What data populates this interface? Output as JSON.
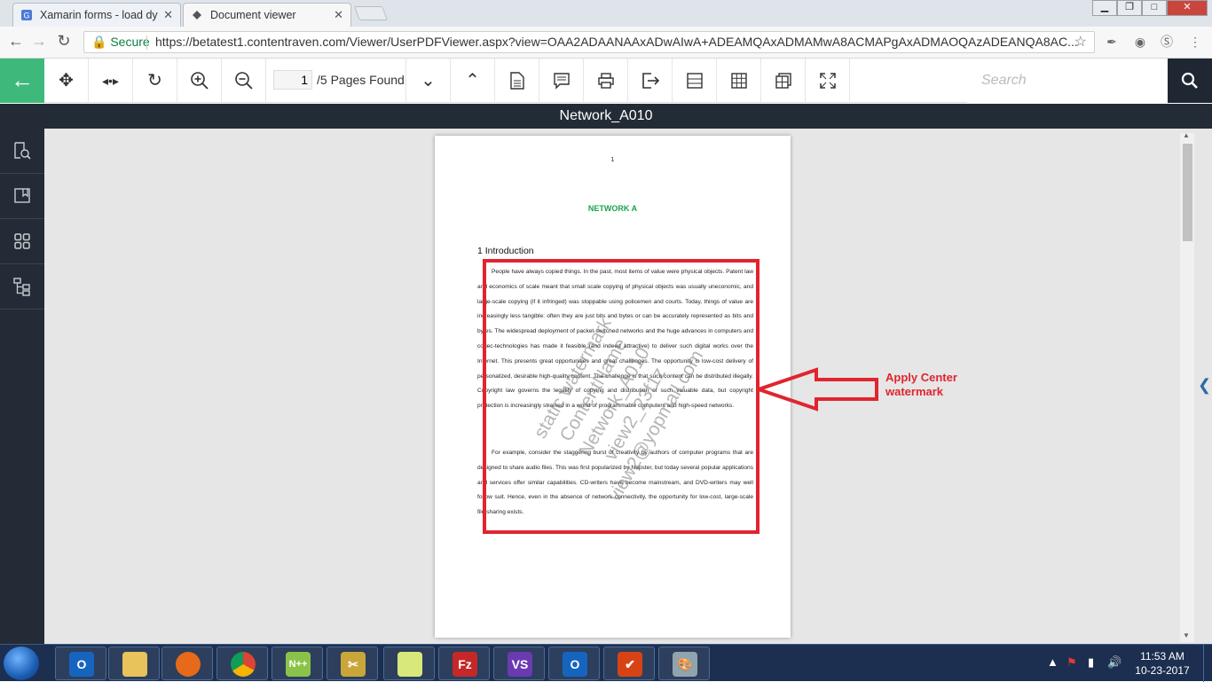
{
  "browser": {
    "tabs": [
      {
        "title": "Xamarin forms - load dy"
      },
      {
        "title": "Document viewer"
      }
    ],
    "address": {
      "secure_label": "Secure",
      "url": "https://betatest1.contentraven.com/Viewer/UserPDFViewer.aspx?view=OAA2ADAANAAxADwAIwA+ADEAMQAxADMAMwA8ACMAPgAxADMAOQAzADEANQA8AC..."
    }
  },
  "toolbar": {
    "page_current": "1",
    "pages_found": "/5 Pages Found",
    "search_placeholder": "Search"
  },
  "document": {
    "name": "Network_A010",
    "page_number": "1",
    "title": "NETWORK A",
    "section_heading": "1 Introduction",
    "paragraphs": [
      "People have always copied things. In the past, most items of value were physical objects. Patent law and economics of scale meant that small scale copying of physical objects was usually uneconomic, and large-scale copying (if it infringed) was stoppable using policemen and courts. Today, things of value are increasingly less tangible: often they are just bits and bytes or can be accurately represented as bits and bytes. The widespread deployment of packet-switched networks and the huge advances in computers and codec-technologies has made it feasible (and indeed attractive) to deliver such digital works over the Internet. This presents great opportunities and great challenges. The opportunity is low-cost delivery of personalized, desirable high-quality content. The challenge is that such content can be distributed illegally. Copyright law governs the legality of copying and distribution of such valuable data, but copyright protection is increasingly strained in a world of programmable computers and high-speed networks.",
      "For example, consider the staggering burst of creativity by authors of computer programs that are designed to share audio files. This was first popularized by Napster, but today several popular applications and services offer similar capabilities. CD-writers have become mainstream, and DVD-writers may well follow suit. Hence, even in the absence of network connectivity, the opportunity for low-cost, large-scale file sharing exists."
    ],
    "watermark_lines": [
      "static watermark",
      "ContentName",
      "Network_A010",
      "view2_23f1z",
      "view2@yopmail.com"
    ]
  },
  "annotation": {
    "line1": "Apply Center",
    "line2": "watermark",
    "color": "#e0252f"
  },
  "taskbar": {
    "time": "11:53 AM",
    "date": "10-23-2017"
  }
}
